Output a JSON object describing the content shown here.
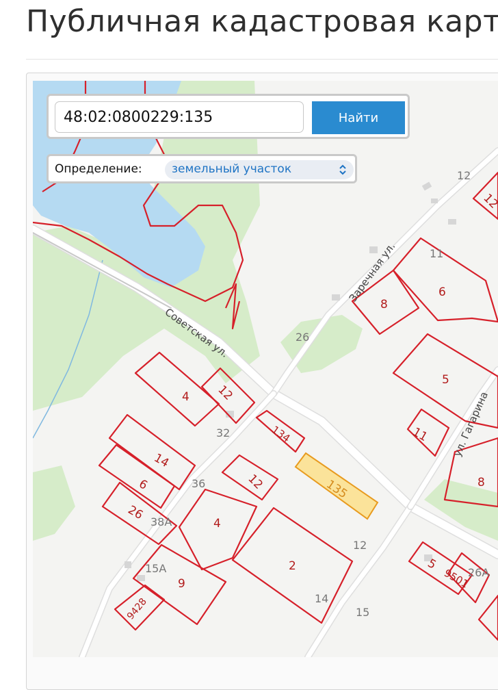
{
  "header": {
    "title": "Публичная кадастровая карт"
  },
  "search": {
    "value": "48:02:0800229:135",
    "button_label": "Найти"
  },
  "definition": {
    "label": "Определение:",
    "selected": "земельный участок",
    "icon": "updown-chevron-icon"
  },
  "colors": {
    "accent": "#2a8bd0",
    "parcel_border": "#d6202a",
    "selected_parcel": "#fbe39a",
    "water": "#b5daf2",
    "forest": "#d6ecc9"
  },
  "streets": {
    "sovetskaya": "Советская ул.",
    "zarechnaya": "Заречная ул.",
    "gagarina": "ул. Гагарина"
  },
  "house_numbers": {
    "n12": "12",
    "n11": "11",
    "n26": "26",
    "n32": "32",
    "n36": "36",
    "n38a": "38А",
    "n15a": "15А",
    "n12b": "12",
    "n14": "14",
    "n15": "15",
    "n26a": "26А"
  },
  "parcels": {
    "p12a": "12",
    "p8a": "8",
    "p6": "6",
    "p5": "5",
    "p4a": "4",
    "p12b": "12",
    "p11": "11",
    "p14": "14",
    "p6b": "6",
    "p26": "26",
    "p134": "134",
    "p12c": "12",
    "p135": "135",
    "p4b": "4",
    "p2": "2",
    "p9": "9",
    "p9428": "9428",
    "p8b": "8",
    "p5b": "5",
    "p9501": "9501"
  }
}
